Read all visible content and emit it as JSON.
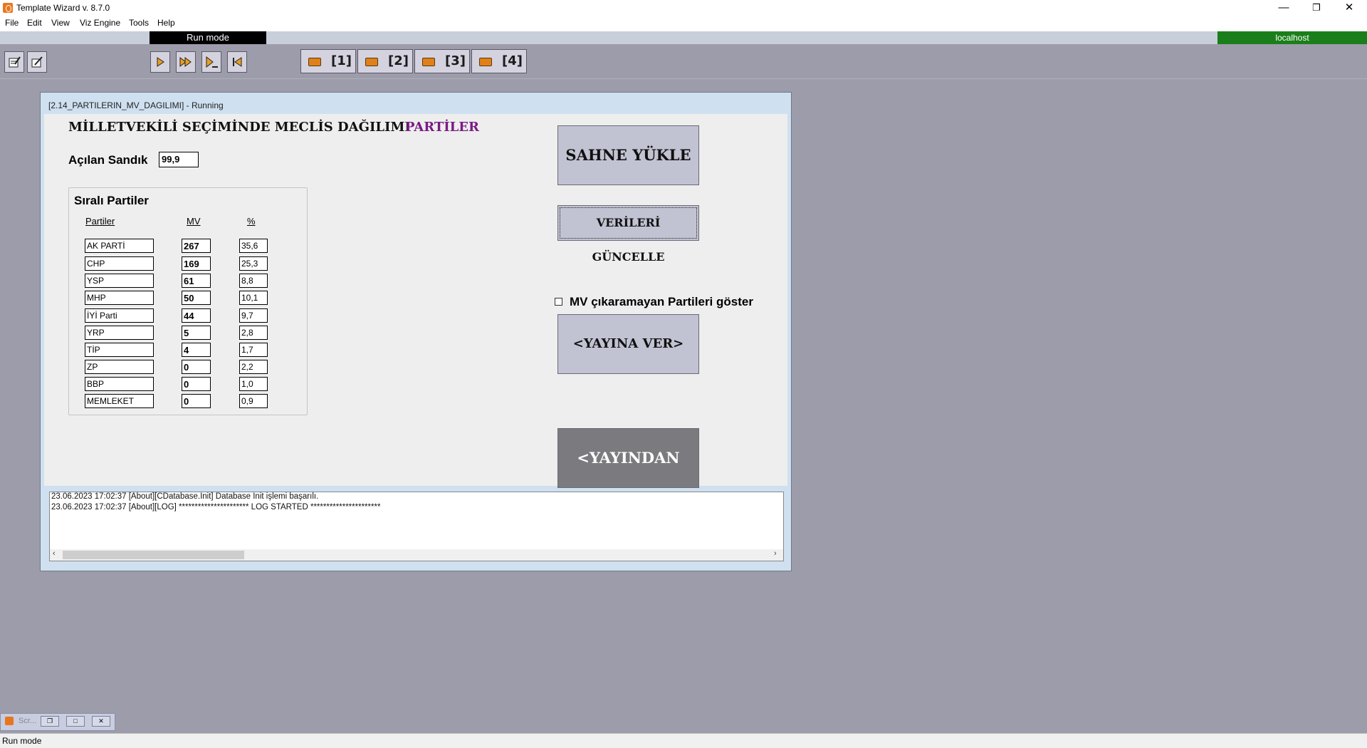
{
  "window": {
    "title": "Template Wizard v. 8.7.0"
  },
  "menu": {
    "items": [
      "File",
      "Edit",
      "View",
      "Viz Engine",
      "Tools",
      "Help"
    ]
  },
  "topbar": {
    "mode": "Run mode",
    "host": "localhost"
  },
  "cameras": [
    "[1]",
    "[2]",
    "[3]",
    "[4]"
  ],
  "template": {
    "window_title": "[2.14_PARTILERIN_MV_DAGILIMI] - Running",
    "heading": "MİLLETVEKİLİ SEÇİMİNDE MECLİS DAĞILIMI",
    "heading_accent": "PARTİLER",
    "sandik_label": "Açılan Sandık",
    "sandik_value": "99,9",
    "group_title": "Sıralı Partiler",
    "columns": {
      "party": "Partiler",
      "mv": "MV",
      "pct": "%"
    },
    "rows": [
      {
        "party": "AK PARTİ",
        "mv": "267",
        "pct": "35,6"
      },
      {
        "party": "CHP",
        "mv": "169",
        "pct": "25,3"
      },
      {
        "party": "YSP",
        "mv": "61",
        "pct": "8,8"
      },
      {
        "party": "MHP",
        "mv": "50",
        "pct": "10,1"
      },
      {
        "party": "İYİ Parti",
        "mv": "44",
        "pct": "9,7"
      },
      {
        "party": "YRP",
        "mv": "5",
        "pct": "2,8"
      },
      {
        "party": "TİP",
        "mv": "4",
        "pct": "1,7"
      },
      {
        "party": "ZP",
        "mv": "0",
        "pct": "2,2"
      },
      {
        "party": "BBP",
        "mv": "0",
        "pct": "1,0"
      },
      {
        "party": "MEMLEKET",
        "mv": "0",
        "pct": "0,9"
      }
    ],
    "buttons": {
      "load": "SAHNE YÜKLE",
      "update": "VERİLERİ GÜNCELLE",
      "show_checkbox": "MV çıkaramayan Partileri göster",
      "on_air": "<YAYINA VER>",
      "off_air": "<YAYINDAN AL>"
    },
    "log": [
      "23.06.2023 17:02:37 [About][CDatabase.Init] Database Init işlemi başarılı.",
      "23.06.2023 17:02:37 [About][LOG] ********************** LOG STARTED **********************"
    ]
  },
  "minimized": {
    "label": "Scr..."
  },
  "status": {
    "text": "Run mode"
  }
}
